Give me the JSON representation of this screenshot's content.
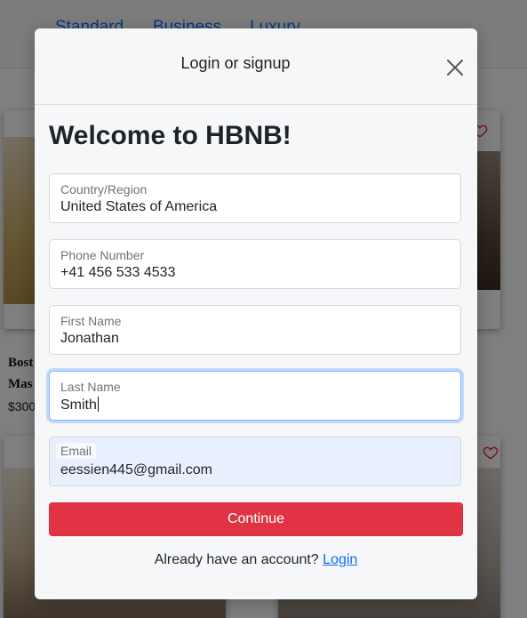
{
  "background": {
    "tabs": [
      "Standard",
      "Business",
      "Luxury"
    ],
    "card_title_line1": "Bost",
    "card_title_line2": "Mas",
    "card_price": "$300"
  },
  "modal": {
    "title": "Login or signup",
    "heading": "Welcome to HBNB!",
    "fields": [
      {
        "label": "Country/Region",
        "value": "United States of America"
      },
      {
        "label": "Phone Number",
        "value": "+41 456 533 4533"
      },
      {
        "label": "First Name",
        "value": "Jonathan"
      },
      {
        "label": "Last Name",
        "value": "Smith"
      },
      {
        "label": "Email",
        "value": "eessien445@gmail.com"
      }
    ],
    "continue_label": "Continue",
    "footer_text": "Already have an account?",
    "login_link": "Login"
  },
  "colors": {
    "accent_red": "#e03444",
    "link_blue": "#0d6efd"
  }
}
